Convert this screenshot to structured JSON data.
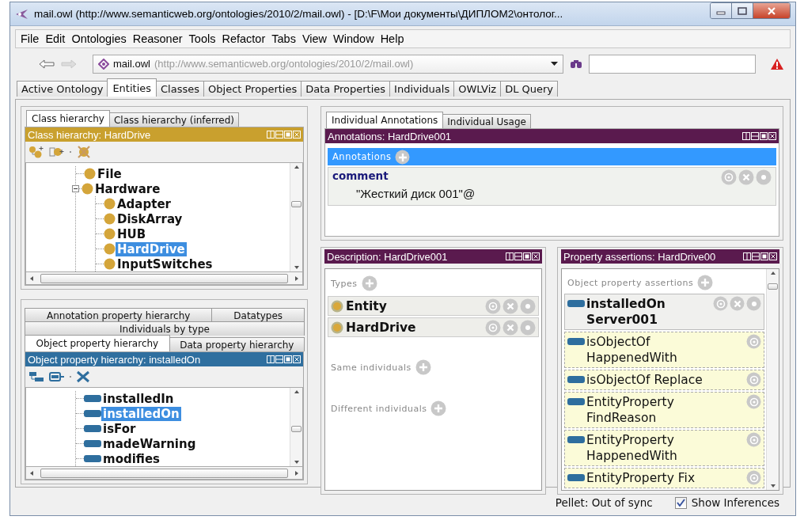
{
  "window": {
    "title": "mail.owl (http://www.semanticweb.org/ontologies/2010/2/mail.owl) - [D:\\F\\Мои документы\\ДИПЛОМ2\\онтолог..."
  },
  "menu": [
    "File",
    "Edit",
    "Ontologies",
    "Reasoner",
    "Tools",
    "Refactor",
    "Tabs",
    "View",
    "Window",
    "Help"
  ],
  "toolbar": {
    "back": {
      "disabled": false
    },
    "forward": {
      "disabled": true
    },
    "ontology": {
      "name": "mail.owl",
      "iri": "(http://www.semanticweb.org/ontologies/2010/2/mail.owl)"
    }
  },
  "tabs": [
    {
      "label": "Active Ontology",
      "selected": false
    },
    {
      "label": "Entities",
      "selected": true
    },
    {
      "label": "Classes",
      "selected": false
    },
    {
      "label": "Object Properties",
      "selected": false
    },
    {
      "label": "Data Properties",
      "selected": false
    },
    {
      "label": "Individuals",
      "selected": false
    },
    {
      "label": "OWLViz",
      "selected": false
    },
    {
      "label": "DL Query",
      "selected": false
    }
  ],
  "class_hierarchy": {
    "tabs": [
      {
        "label": "Class hierarchy",
        "selected": true
      },
      {
        "label": "Class hierarchy (inferred)",
        "selected": false
      }
    ],
    "title": "Class hierarchy: HardDrive",
    "tree": [
      {
        "label": "File",
        "selected": false
      },
      {
        "label": "Hardware",
        "selected": false,
        "expanded": true,
        "children": [
          {
            "label": "Adapter",
            "selected": false
          },
          {
            "label": "DiskArray",
            "selected": false
          },
          {
            "label": "HUB",
            "selected": false
          },
          {
            "label": "HardDrive",
            "selected": true
          },
          {
            "label": "InputSwitches",
            "selected": false
          }
        ]
      }
    ]
  },
  "property_hierarchy": {
    "tab_rows": [
      [
        {
          "label": "Annotation property hierarchy",
          "selected": false
        },
        {
          "label": "Datatypes",
          "selected": false
        }
      ],
      [
        {
          "label": "Individuals by type",
          "selected": false
        }
      ],
      [
        {
          "label": "Object property hierarchy",
          "selected": true
        },
        {
          "label": "Data property hierarchy",
          "selected": false
        }
      ]
    ],
    "title": "Object property hierarchy: installedOn",
    "tree": [
      {
        "label": "installedIn",
        "selected": false
      },
      {
        "label": "installedOn",
        "selected": true
      },
      {
        "label": "isFor",
        "selected": false
      },
      {
        "label": "madeWarning",
        "selected": false
      },
      {
        "label": "modifies",
        "selected": false
      }
    ]
  },
  "annotations": {
    "tabs": [
      {
        "label": "Individual Annotations",
        "selected": true
      },
      {
        "label": "Individual Usage",
        "selected": false
      }
    ],
    "title": "Annotations: HardDrive001",
    "header": "Annotations",
    "items": [
      {
        "property": "comment",
        "value": "\"Жесткий диск 001\"@"
      }
    ]
  },
  "description": {
    "title": "Description: HardDrive001",
    "sections": [
      {
        "label": "Types",
        "items": [
          "Entity",
          "HardDrive"
        ]
      },
      {
        "label": "Same individuals"
      },
      {
        "label": "Different individuals"
      }
    ]
  },
  "property_assertions": {
    "title": "Property assertions: HardDrive00",
    "header": "Object property assertions",
    "items": [
      {
        "property": "installedOn",
        "value": "Server001",
        "inferred": false
      },
      {
        "property": "isObjectOf",
        "value": "HappenedWith",
        "inferred": true
      },
      {
        "property": "isObjectOf",
        "value": "Replace",
        "inferred": true
      },
      {
        "property": "EntityProperty",
        "value": "FindReason",
        "inferred": true
      },
      {
        "property": "EntityProperty",
        "value": "HappenedWith",
        "inferred": true
      },
      {
        "property": "EntityProperty",
        "value": "Fix",
        "inferred": true
      }
    ]
  },
  "status_bar": {
    "reasoner": "Pellet: Out of sync",
    "show_inferences": {
      "label": "Show Inferences",
      "checked": true
    }
  }
}
